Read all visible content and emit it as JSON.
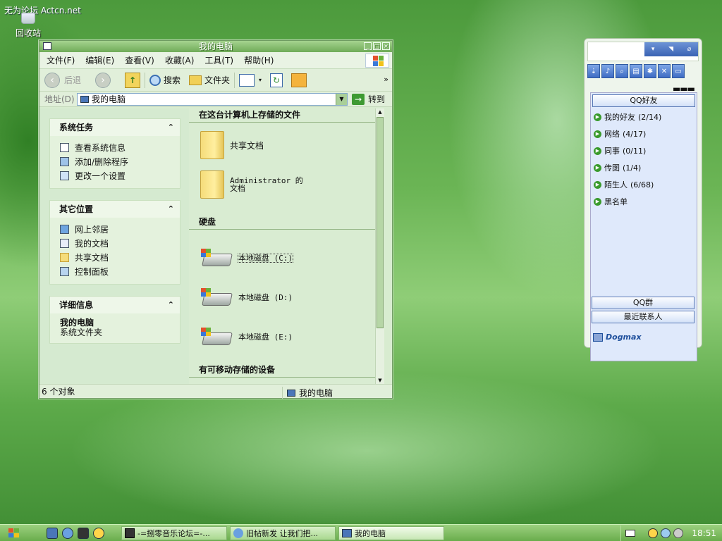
{
  "desktop": {
    "watermark": "无为论坛 Actcn.net",
    "icons": [
      {
        "label": "回收站"
      }
    ]
  },
  "explorer": {
    "title": "我的电脑",
    "menu": [
      "文件(F)",
      "编辑(E)",
      "查看(V)",
      "收藏(A)",
      "工具(T)",
      "帮助(H)"
    ],
    "toolbar": {
      "back": "后退",
      "search": "搜索",
      "folders": "文件夹",
      "more": "»"
    },
    "address": {
      "label": "地址(D)",
      "value": "我的电脑",
      "go": "转到"
    },
    "tasks": {
      "system": {
        "title": "系统任务",
        "items": [
          "查看系统信息",
          "添加/删除程序",
          "更改一个设置"
        ]
      },
      "places": {
        "title": "其它位置",
        "items": [
          "网上邻居",
          "我的文档",
          "共享文档",
          "控制面板"
        ]
      },
      "details": {
        "title": "详细信息",
        "name": "我的电脑",
        "desc": "系统文件夹"
      }
    },
    "sections": {
      "files": "在这台计算机上存储的文件",
      "hdd": "硬盘",
      "removable": "有可移动存储的设备"
    },
    "files": [
      "共享文档",
      "Administrator 的文档"
    ],
    "drives": [
      "本地磁盘 (C:)",
      "本地磁盘 (D:)",
      "本地磁盘 (E:)"
    ],
    "status": {
      "count": "6 个对象",
      "location": "我的电脑"
    }
  },
  "qq": {
    "friends_btn": "QQ好友",
    "groups": [
      {
        "name": "我的好友",
        "count": "(2/14)"
      },
      {
        "name": "网络",
        "count": "(4/17)"
      },
      {
        "name": "同事",
        "count": "(0/11)"
      },
      {
        "name": "传图",
        "count": "(1/4)"
      },
      {
        "name": "陌生人",
        "count": "(6/68)"
      },
      {
        "name": "黑名单",
        "count": ""
      }
    ],
    "qun_btn": "QQ群",
    "recent_btn": "最近联系人",
    "brand": "Dogmax"
  },
  "taskbar": {
    "tasks": [
      "-=捌零音乐论坛=-...",
      "旧帖新发 让我们把...",
      "我的电脑"
    ],
    "clock": "18:51"
  },
  "colors": {
    "accent": "#6fab58",
    "qq_blue": "#3a63b4"
  }
}
